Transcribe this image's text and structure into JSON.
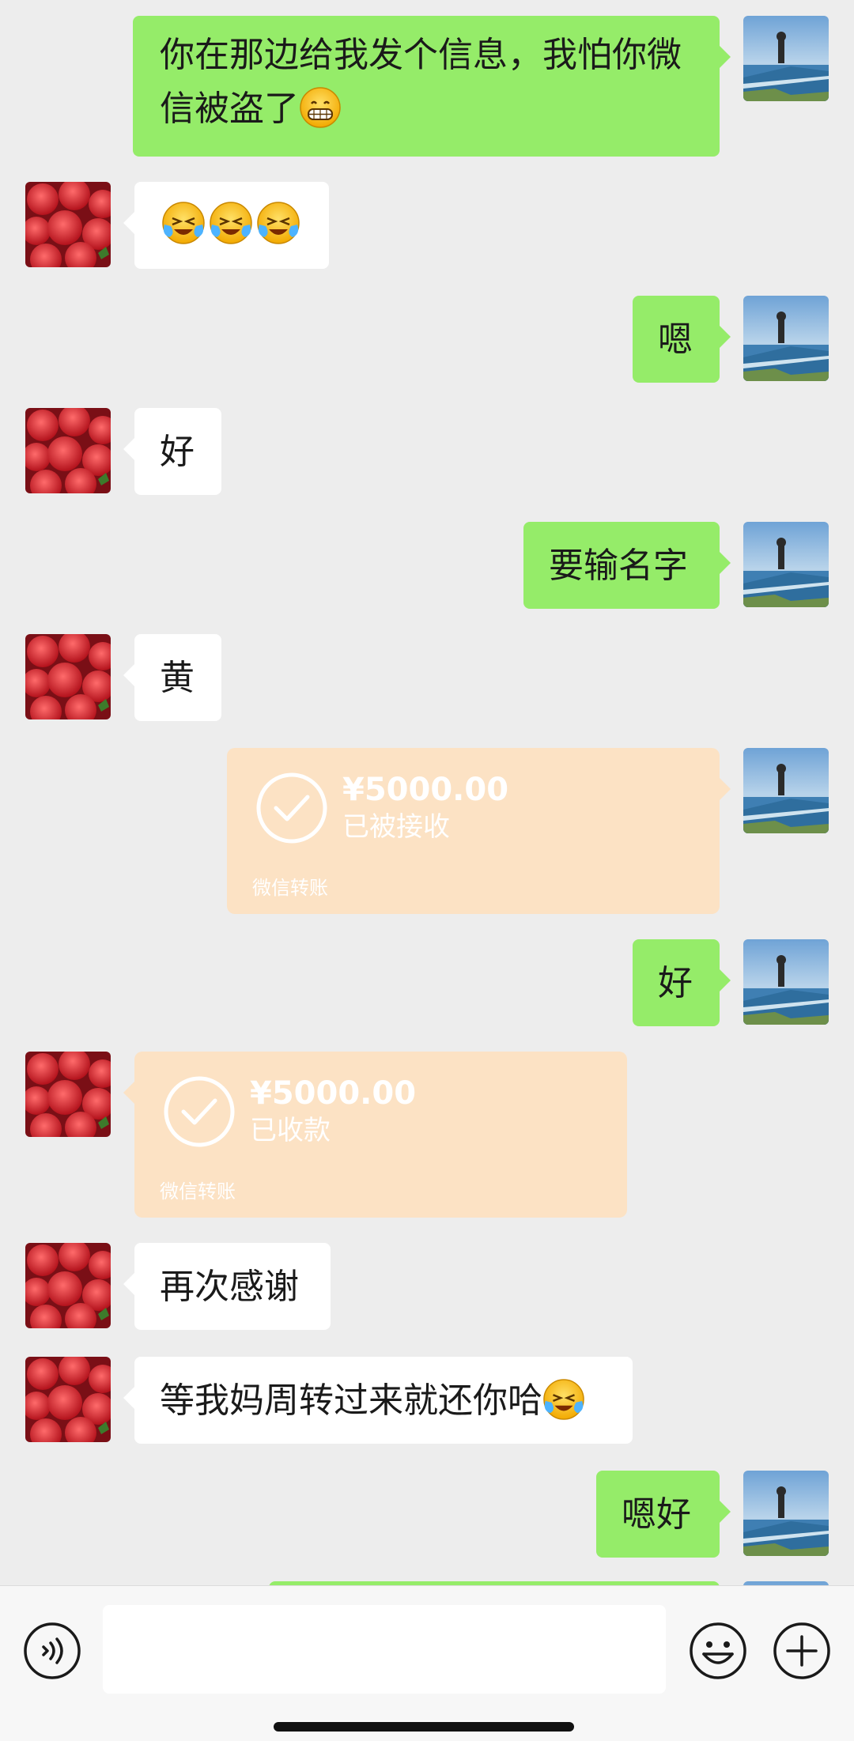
{
  "conversation": {
    "messages": [
      {
        "from": "me",
        "text": "你在那边给我发个信息，我怕你微信被盗了",
        "emoji": "grin-emoji"
      },
      {
        "from": "them",
        "text": "",
        "emoji": "crying-laughing-emoji x3"
      },
      {
        "from": "me",
        "text": "嗯"
      },
      {
        "from": "them",
        "text": "好"
      },
      {
        "from": "me",
        "text": "要输名字"
      },
      {
        "from": "them",
        "text": "黄"
      },
      {
        "from": "me",
        "type": "transfer",
        "amount": "¥5000.00",
        "status": "已被接收",
        "label": "微信转账"
      },
      {
        "from": "me",
        "text": "好"
      },
      {
        "from": "them",
        "type": "transfer",
        "amount": "¥5000.00",
        "status": "已收款",
        "label": "微信转账"
      },
      {
        "from": "them",
        "text": "再次感谢"
      },
      {
        "from": "them",
        "text": "等我妈周转过来就还你哈",
        "emoji": "crying-laughing-emoji"
      },
      {
        "from": "me",
        "text": "嗯好"
      }
    ]
  },
  "input_bar": {
    "placeholder": "",
    "value": "",
    "icons": [
      "voice-icon",
      "emoji-face-icon",
      "plus-icon"
    ]
  },
  "colors": {
    "background": "#ededed",
    "outgoing_bubble": "#95ec69",
    "incoming_bubble": "#ffffff",
    "transfer_card": "#fce2c4"
  }
}
